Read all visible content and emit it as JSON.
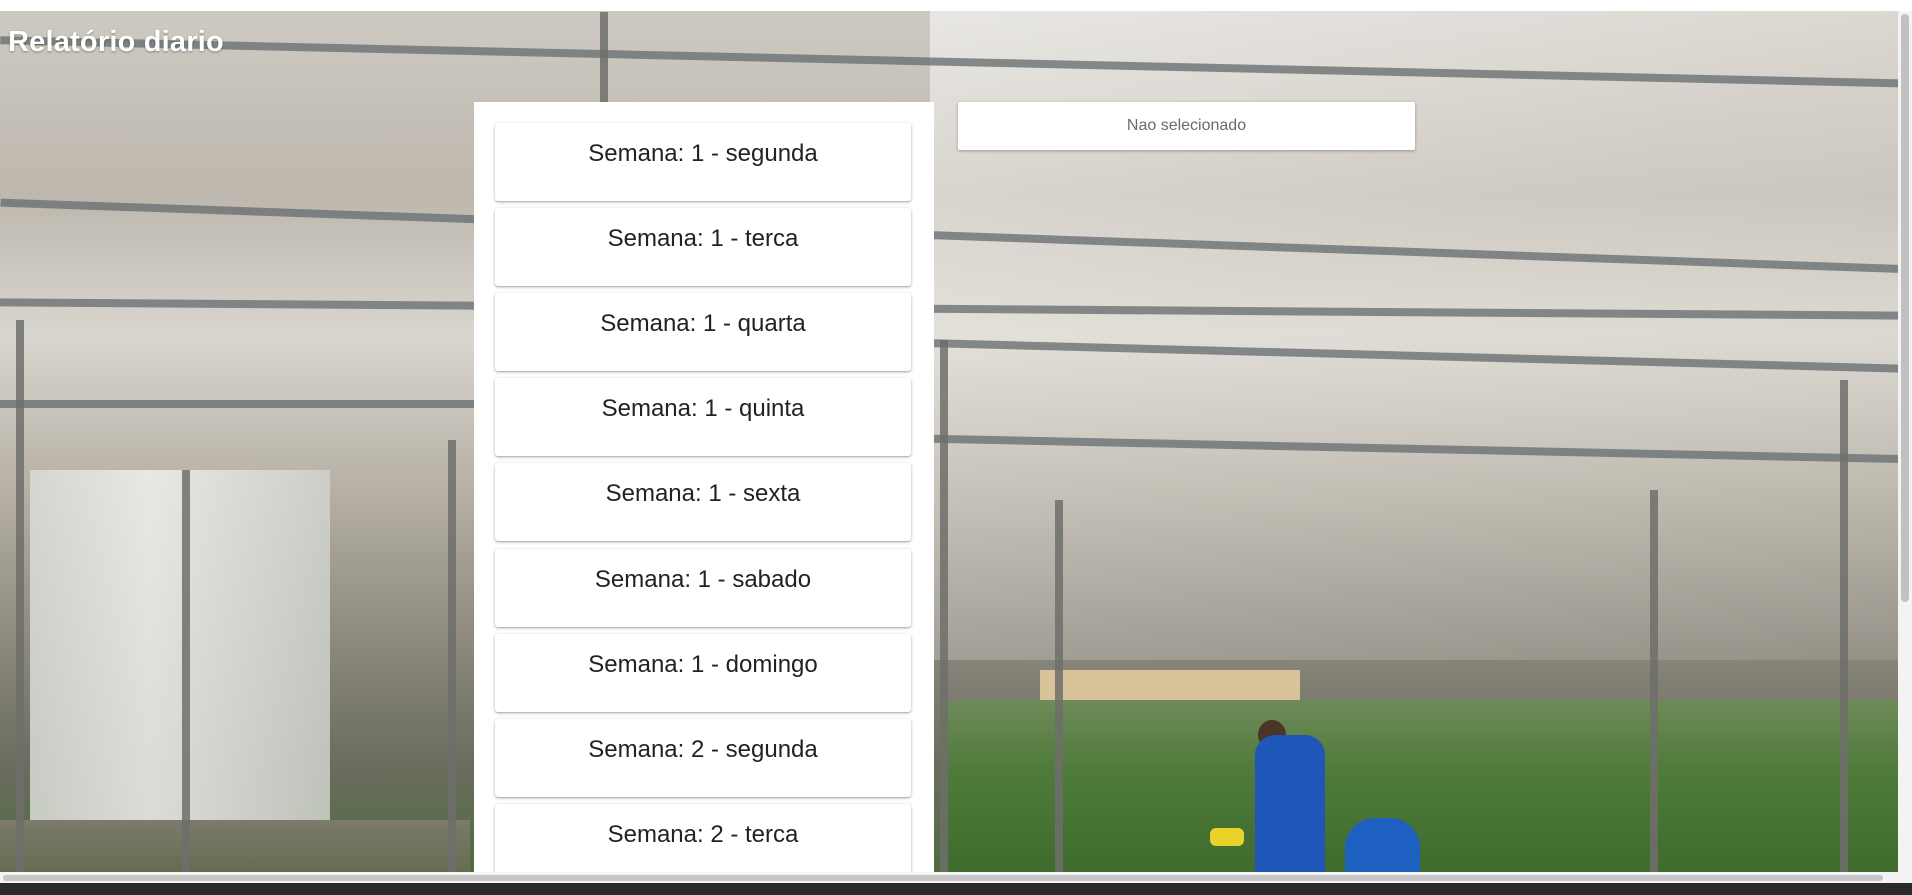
{
  "header": {
    "title": "Relatório diario"
  },
  "days": [
    {
      "label": "Semana: 1 - segunda"
    },
    {
      "label": "Semana: 1 - terca"
    },
    {
      "label": "Semana: 1 - quarta"
    },
    {
      "label": "Semana: 1 - quinta"
    },
    {
      "label": "Semana: 1 - sexta"
    },
    {
      "label": "Semana: 1 - sabado"
    },
    {
      "label": "Semana: 1 - domingo"
    },
    {
      "label": "Semana: 2 - segunda"
    },
    {
      "label": "Semana: 2 - terca"
    }
  ],
  "selection": {
    "status_text": "Nao selecionado"
  },
  "background": {
    "subject": "greenhouse-photo"
  }
}
